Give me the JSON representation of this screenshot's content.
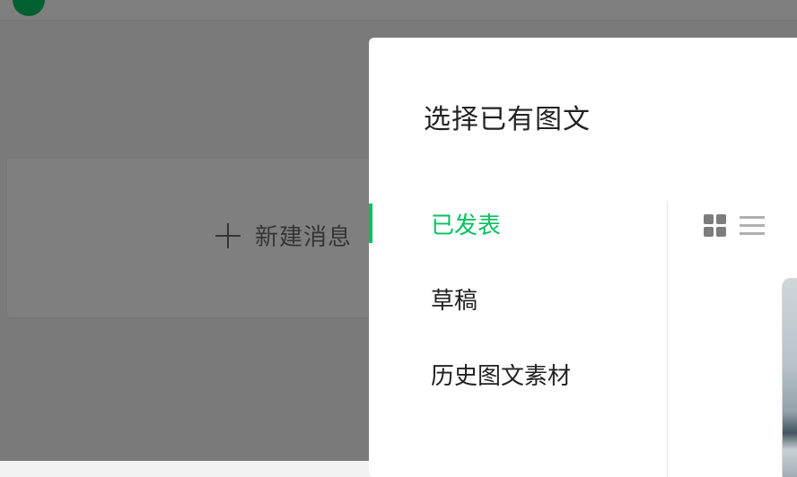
{
  "background": {
    "new_message_label": "新建消息",
    "plus_icon": "plus-icon"
  },
  "dialog": {
    "title": "选择已有图文",
    "tabs": [
      {
        "label": "已发表",
        "active": true
      },
      {
        "label": "草稿",
        "active": false
      },
      {
        "label": "历史图文素材",
        "active": false
      }
    ],
    "view_toggles": {
      "grid_icon": "grid-view-icon",
      "list_icon": "list-view-icon",
      "selected": "grid"
    }
  },
  "colors": {
    "accent": "#07c160",
    "overlay": "rgba(0,0,0,0.5)"
  }
}
